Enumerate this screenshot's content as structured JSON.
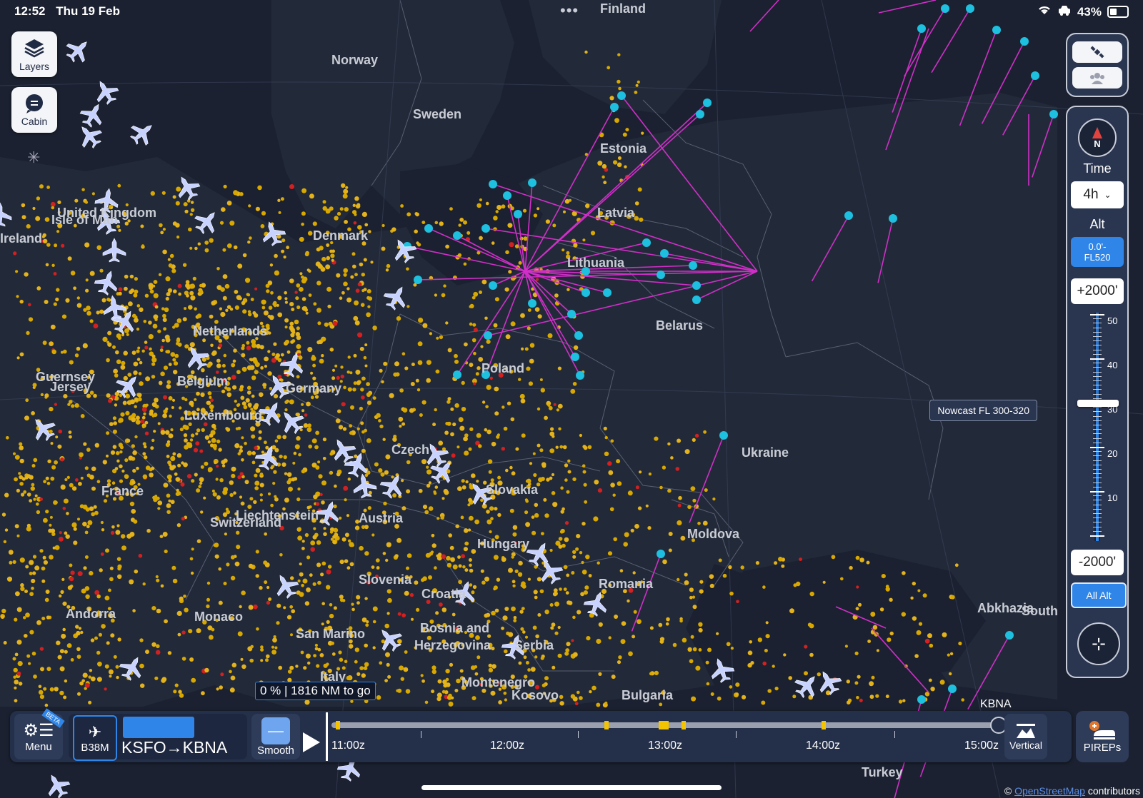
{
  "status_bar": {
    "time": "12:52",
    "date": "Thu 19 Feb",
    "more": "•••",
    "top_place": "Finland",
    "battery": "43%"
  },
  "left_tools": {
    "layers_label": "Layers",
    "cabin_label": "Cabin"
  },
  "map": {
    "places": [
      {
        "name": "Finland"
      },
      {
        "name": "Norway"
      },
      {
        "name": "Sweden"
      },
      {
        "name": "Estonia"
      },
      {
        "name": "Latvia"
      },
      {
        "name": "Lithuania"
      },
      {
        "name": "Denmark"
      },
      {
        "name": "Belarus"
      },
      {
        "name": "United Kingdom"
      },
      {
        "name": "Isle of Man"
      },
      {
        "name": "Ireland"
      },
      {
        "name": "Netherlands"
      },
      {
        "name": "Belgium"
      },
      {
        "name": "Guernsey"
      },
      {
        "name": "Jersey"
      },
      {
        "name": "Germany"
      },
      {
        "name": "Luxembourg"
      },
      {
        "name": "Poland"
      },
      {
        "name": "Czech"
      },
      {
        "name": "Slovakia"
      },
      {
        "name": "France"
      },
      {
        "name": "Liechtenstein"
      },
      {
        "name": "Switzerland"
      },
      {
        "name": "Austria"
      },
      {
        "name": "Hungary"
      },
      {
        "name": "Ukraine"
      },
      {
        "name": "Moldova"
      },
      {
        "name": "Romania"
      },
      {
        "name": "Slovenia"
      },
      {
        "name": "Croatia"
      },
      {
        "name": "Andorra"
      },
      {
        "name": "Monaco"
      },
      {
        "name": "San Marino"
      },
      {
        "name": "Bosnia and"
      },
      {
        "name": "Herzegovina"
      },
      {
        "name": "Serbia"
      },
      {
        "name": "Italy"
      },
      {
        "name": "Montenegro"
      },
      {
        "name": "Kosovo"
      },
      {
        "name": "Bulgaria"
      },
      {
        "name": "Abkhazia"
      },
      {
        "name": "South"
      },
      {
        "name": "Turkey"
      }
    ]
  },
  "right_panel": {
    "compass_n": "N",
    "time_label": "Time",
    "time_value": "4h",
    "alt_label": "Alt",
    "alt_range": [
      "0.0'-",
      "FL520"
    ],
    "upper_offset": "+2000'",
    "lower_offset": "-2000'",
    "all_alt": "All Alt",
    "scale": [
      "50",
      "40",
      "30",
      "20",
      "10"
    ]
  },
  "nowcast_label": "Nowcast FL 300-320",
  "bottom": {
    "progress": "0 % | 1816 NM to go",
    "menu_label": "Menu",
    "beta": "BETA",
    "aircraft": "B38M",
    "route": "KSFO→KBNA",
    "smooth_label": "Smooth",
    "times": [
      "11:00z",
      "12:00z",
      "13:00z",
      "14:00z",
      "15:00z"
    ],
    "destination": "KBNA",
    "vertical_label": "Vertical",
    "pireps_label": "PIREPs"
  },
  "attribution": {
    "prefix": "©",
    "link": "OpenStreetMap",
    "suffix": "contributors"
  },
  "colors": {
    "sea": "#1b2130",
    "land": "#232a3a",
    "turbulence_light": "#d9a800",
    "turbulence_moderate": "#e4b21a",
    "turbulence_severe": "#d32020",
    "pirep_point": "#1ec0e0",
    "pirep_track": "#d02fc8",
    "aircraft": "#c7d2ff",
    "accent": "#2f86e8"
  }
}
